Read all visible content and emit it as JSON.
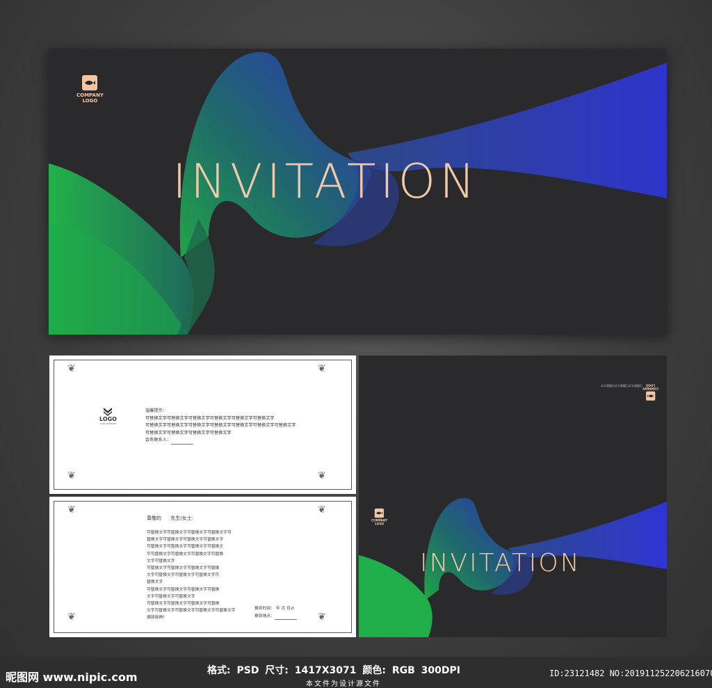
{
  "cover": {
    "title": "INVITATION",
    "logo": {
      "line1": "COMPANY",
      "line2": "LOGO"
    }
  },
  "inside_top": {
    "logo_label": "LOGO",
    "logo_sub": "SLOGAN BRAND",
    "heading": "温馨提示：",
    "lines": [
      "可替换文字可替换文字可替换文字可替换文字可替换文字可替换文字",
      "可替换文字可替换文字可替换文字可替换文字可替换文字可替换文字可替换文字",
      "可替换文字可替换文字可替换文字可替换文字"
    ],
    "contact_label": "会务联系人："
  },
  "inside_bottom": {
    "salutation_prefix": "尊敬的",
    "salutation_suffix": "先生/女士:",
    "body_lines": [
      "可替换文字可替换文字可替换文字可替换文字可",
      "替换文字可替换文字可替换文字可替换文字",
      "可替换文字可替换文字可替换文字可替换文",
      "字可替换文字可替换文字可替换文字可替换",
      "文字可替换文字",
      "可替换文字可替换文字可替换文字可替换",
      "文字可替换文字可替换文字可替换文字可",
      "替换文字",
      "可替换文字可替换文字可替换文字可替换",
      "文字可替换文字可替换文字",
      "可替换文字可替换文字可替换文字可替换",
      "文字可替换文字可替换文字可替换文字可替换文字",
      "顺颂商祺!"
    ],
    "time_label": "报到时间：",
    "time_units": "年  月  日止",
    "place_label": "报到地点："
  },
  "back_top": {
    "logo": {
      "line1": "COMPANY",
      "line2": "LOGO"
    },
    "note": "可替换文字可替换文字可替换文字"
  },
  "back_bottom": {
    "title": "INVITATION",
    "logo": {
      "line1": "COMPANY",
      "line2": "LOGO"
    }
  },
  "footer": {
    "brand": "昵图网 www.nipic.com",
    "specs": "格式: PSD   尺寸: 1417X3071   颜色: RGB   300DPI",
    "subtitle": "本文件为设计源文件",
    "id": "ID:23121482 NO:20191125220621607030"
  },
  "colors": {
    "card_bg": "#2a2a2c",
    "title": "#f0c9a8",
    "ribbon_green": "#1fb24a",
    "ribbon_teal": "#1f6e74",
    "ribbon_blue": "#2b36c8"
  }
}
